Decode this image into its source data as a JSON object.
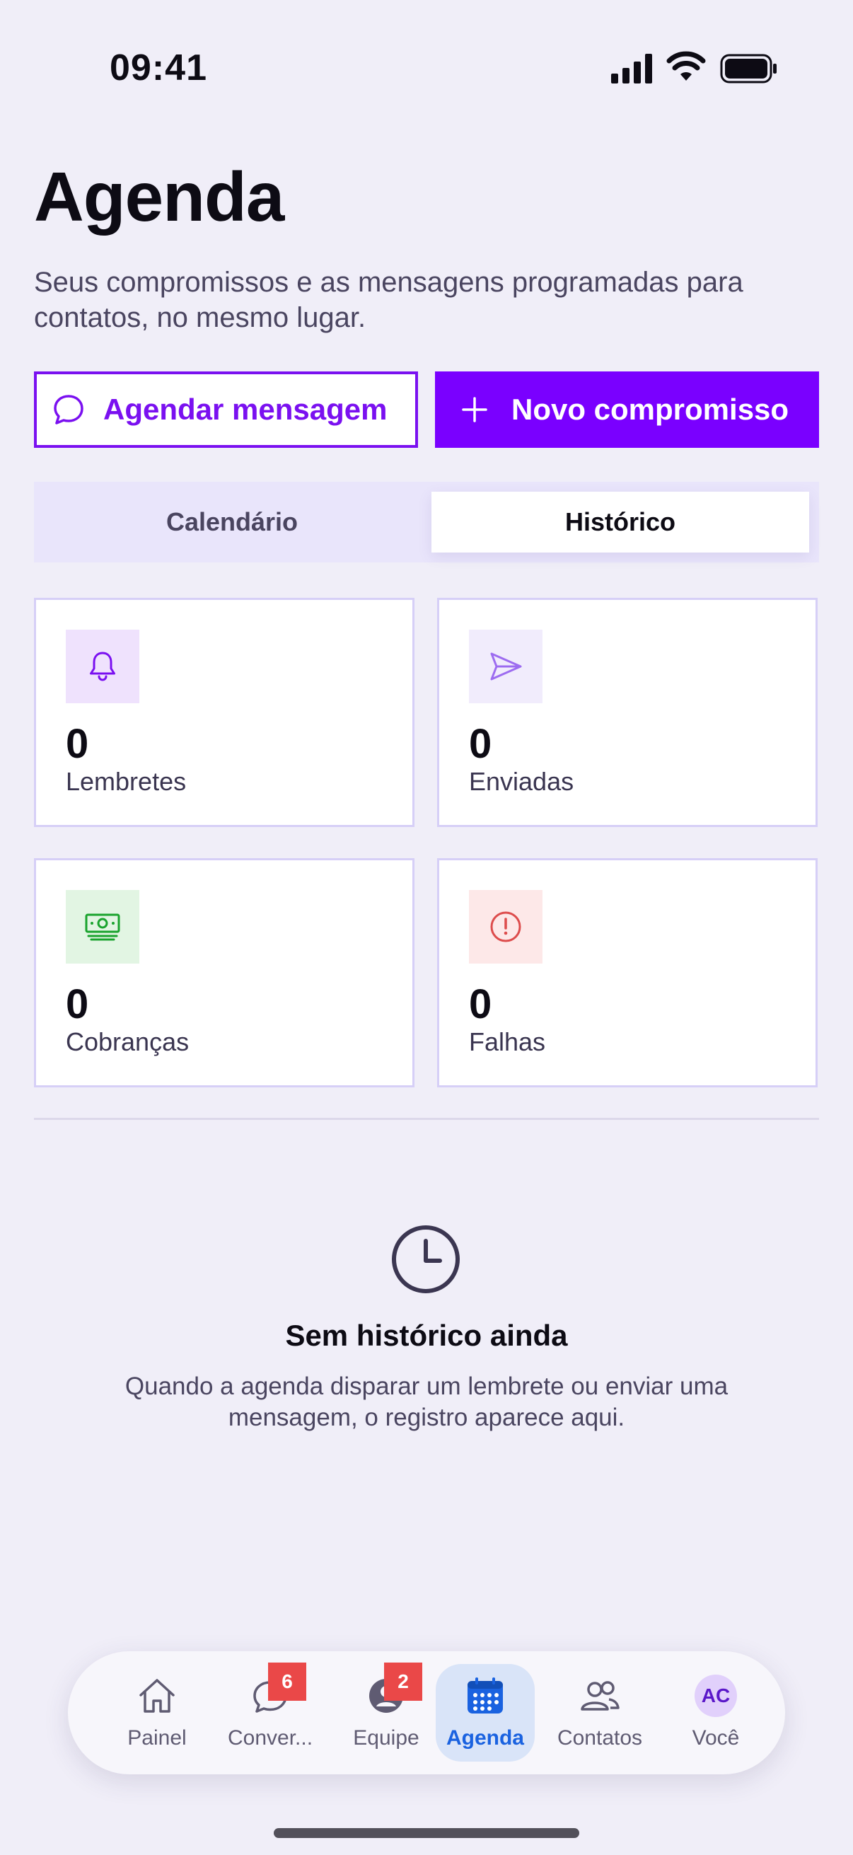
{
  "status_bar": {
    "time": "09:41"
  },
  "header": {
    "title": "Agenda",
    "subtitle": "Seus compromissos e as mensagens programadas para contatos, no mesmo lugar."
  },
  "actions": {
    "schedule_message": "Agendar mensagem",
    "new_appointment": "Novo compromisso"
  },
  "segments": [
    {
      "label": "Calendário",
      "selected": false
    },
    {
      "label": "Histórico",
      "selected": true
    }
  ],
  "stats": [
    {
      "value": "0",
      "label": "Lembretes",
      "icon": "bell-icon",
      "icon_color": "#7a10f0",
      "tile_color": "#efe2fd"
    },
    {
      "value": "0",
      "label": "Enviadas",
      "icon": "send-icon",
      "icon_color": "#9d6cf0",
      "tile_color": "#f1ecfc"
    },
    {
      "value": "0",
      "label": "Cobranças",
      "icon": "money-icon",
      "icon_color": "#1aa32e",
      "tile_color": "#e2f5e3"
    },
    {
      "value": "0",
      "label": "Falhas",
      "icon": "alert-icon",
      "icon_color": "#dd4c4c",
      "tile_color": "#fde8e8"
    }
  ],
  "empty_state": {
    "icon": "clock-icon",
    "title": "Sem histórico ainda",
    "text": "Quando a agenda disparar um lembrete ou enviar uma mensagem, o registro aparece aqui."
  },
  "tabbar": {
    "items": [
      {
        "label": "Painel",
        "icon": "home-icon"
      },
      {
        "label": "Conver...",
        "icon": "chat-icon",
        "badge": "6"
      },
      {
        "label": "Equipe",
        "icon": "team-icon",
        "badge": "2"
      },
      {
        "label": "Agenda",
        "icon": "calendar-icon",
        "active": true
      },
      {
        "label": "Contatos",
        "icon": "contacts-icon"
      },
      {
        "label": "Você",
        "icon": "avatar",
        "avatar_initials": "AC"
      }
    ]
  },
  "colors": {
    "accent": "#7a00ff",
    "active_tab": "#1a62e0",
    "badge": "#ea4848",
    "background": "#f0eef8"
  }
}
